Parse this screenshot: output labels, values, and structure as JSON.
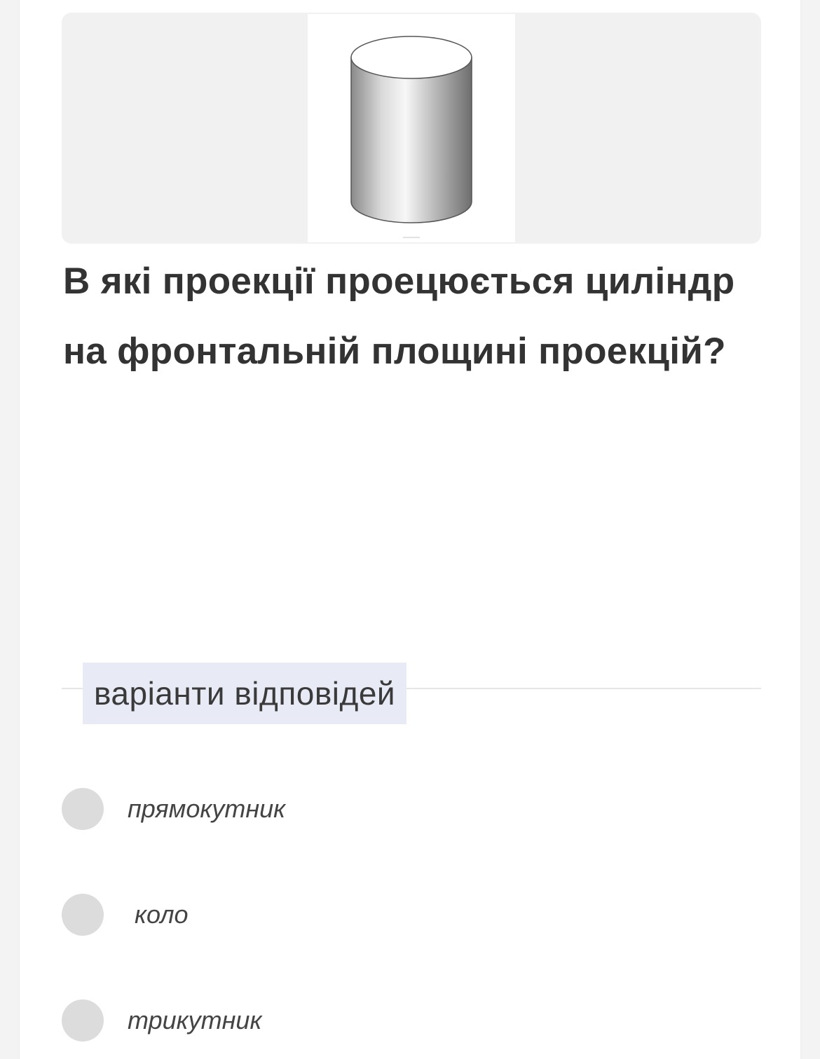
{
  "question": {
    "image": {
      "alt_icon": "cylinder-image"
    },
    "text": "В які проекції проецюється циліндр на фронтальній площині проекцій?"
  },
  "options_section": {
    "label": "варіанти відповідей"
  },
  "options": [
    {
      "label": "прямокутник",
      "selected": false
    },
    {
      "label": "коло",
      "selected": false
    },
    {
      "label": "трикутник",
      "selected": false
    }
  ],
  "colors": {
    "radio": "#dcdcdc",
    "label_bg": "#e8ebf6",
    "image_bg": "#f1f1f1",
    "text": "#333333"
  }
}
